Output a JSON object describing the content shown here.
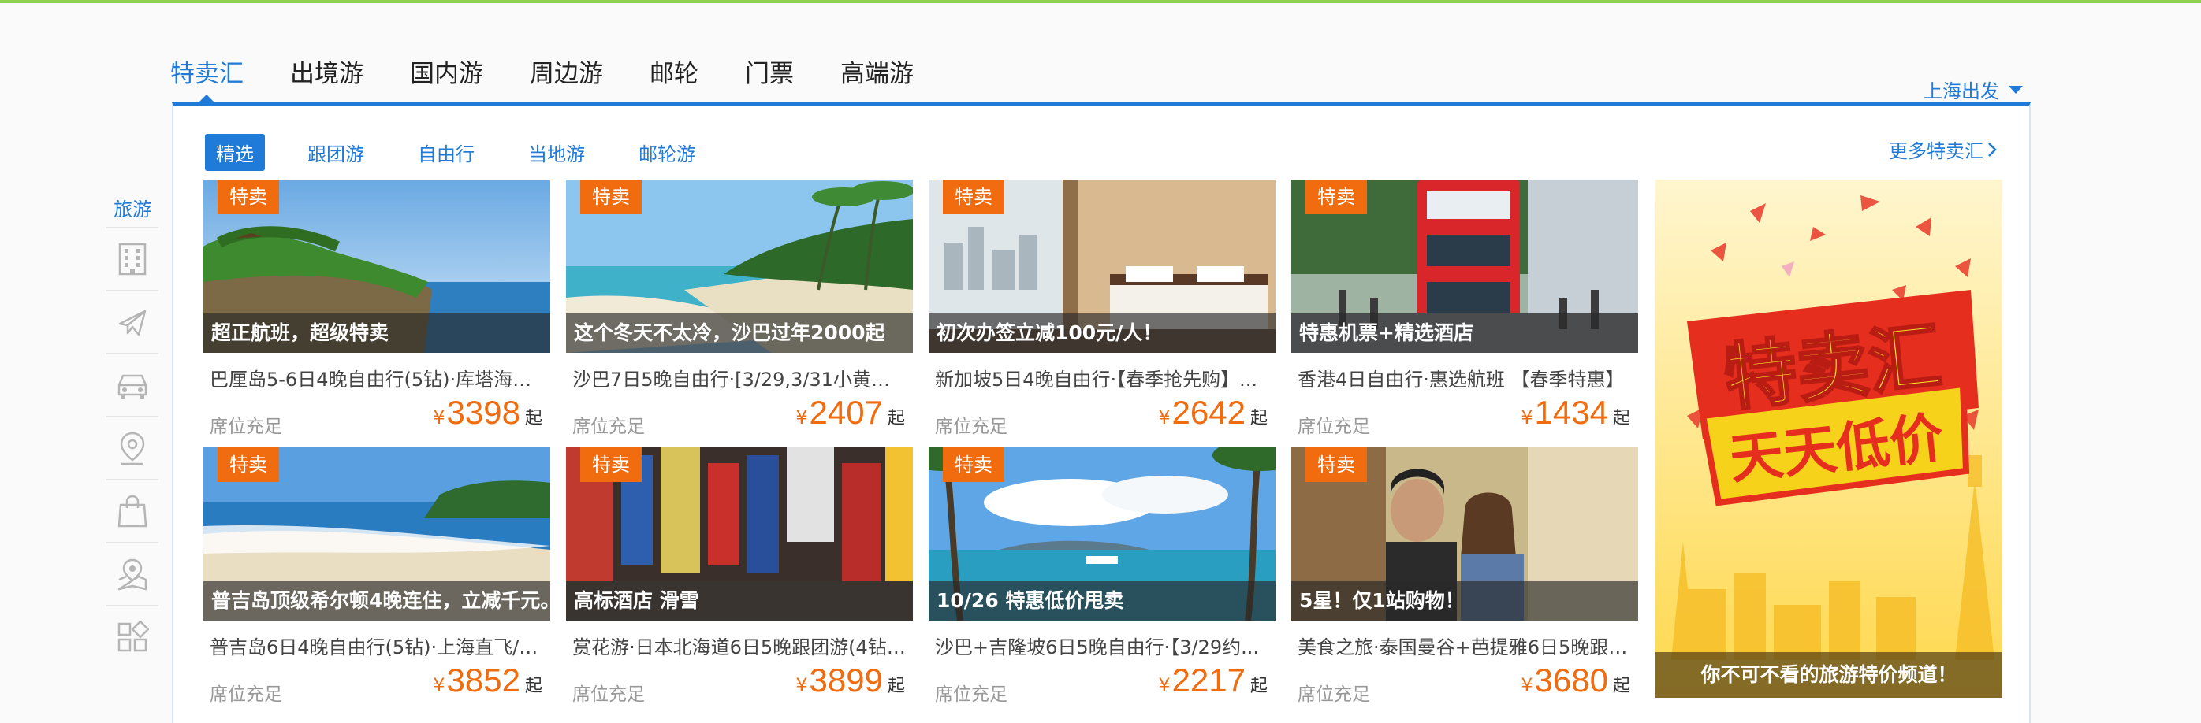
{
  "main_tabs": [
    "特卖汇",
    "出境游",
    "国内游",
    "周边游",
    "邮轮",
    "门票",
    "高端游"
  ],
  "departure_city": "上海出发",
  "sub_tabs": [
    "精选",
    "跟团游",
    "自由行",
    "当地游",
    "邮轮游"
  ],
  "more_link": "更多特卖汇",
  "side_nav": {
    "label": "旅游",
    "items": [
      "hotel-building-icon",
      "airplane-icon",
      "car-icon",
      "map-pin-icon",
      "shopping-bag-icon",
      "map-location-icon",
      "grid-apps-icon"
    ]
  },
  "badge_text": "特卖",
  "currency": "¥",
  "price_suffix": "起",
  "cards": [
    {
      "caption": "超正航班，超级特卖",
      "title": "巴厘岛5-6日4晚自由行(5钻)·库塔海滩...",
      "status": "席位充足",
      "price": "3398"
    },
    {
      "caption": "这个冬天不太冷，沙巴过年2000起",
      "title": "沙巴7日5晚自由行·[3/29,3/31小黄金...",
      "status": "席位充足",
      "price": "2407"
    },
    {
      "caption": "初次办签立减100元/人！",
      "title": "新加坡5日4晚自由行·【春季抢先购】...",
      "status": "席位充足",
      "price": "2642"
    },
    {
      "caption": "特惠机票+精选酒店",
      "title": "香港4日自由行·惠选航班 【春季特惠】",
      "status": "席位充足",
      "price": "1434"
    },
    {
      "caption": "普吉岛顶级希尔顿4晚连住，立减千元。",
      "title": "普吉岛6日4晚自由行(5钻)·上海直飞/3...",
      "status": "席位充足",
      "price": "3852"
    },
    {
      "caption": "高标酒店 滑雪",
      "title": "赏花游·日本北海道6日5晚跟团游(4钻)...",
      "status": "席位充足",
      "price": "3899"
    },
    {
      "caption": "10/26 特惠低价甩卖",
      "title": "沙巴+吉隆坡6日5晚自由行·【3/29约...",
      "status": "席位充足",
      "price": "2217"
    },
    {
      "caption": "5星！仅1站购物！",
      "title": "美食之旅·泰国曼谷+芭提雅6日5晚跟团...",
      "status": "席位充足",
      "price": "3680"
    }
  ],
  "promo": {
    "headline_1": "特卖汇",
    "headline_2": "天天低价",
    "caption": "你不可不看的旅游特价频道！"
  },
  "colors": {
    "accent": "#1f7ad8",
    "price": "#f06c0f",
    "top_line": "#8fd14f"
  }
}
